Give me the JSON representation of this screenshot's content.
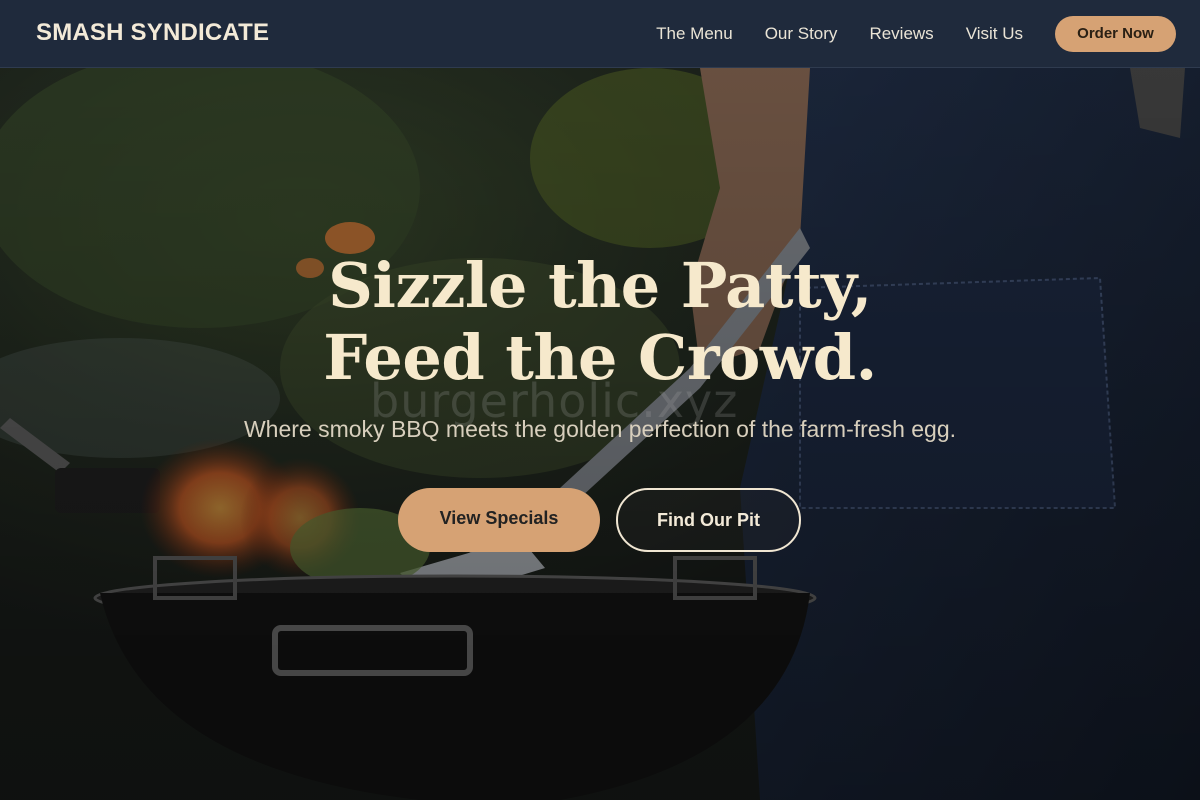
{
  "brand": {
    "name": "SMASH SYNDICATE"
  },
  "nav": {
    "items": [
      {
        "label": "The Menu"
      },
      {
        "label": "Our Story"
      },
      {
        "label": "Reviews"
      },
      {
        "label": "Visit Us"
      }
    ],
    "cta_label": "Order Now"
  },
  "hero": {
    "headline_line1": "Sizzle the Patty,",
    "headline_line2": "Feed the Crowd.",
    "subtitle": "Where smoky BBQ meets the golden perfection of the farm-fresh egg.",
    "watermark": "burgerholic.xyz",
    "primary_button": "View Specials",
    "secondary_button": "Find Our Pit"
  },
  "colors": {
    "header_bg": "#1f2a3c",
    "accent": "#d6a274",
    "headline": "#f6e9cc"
  }
}
